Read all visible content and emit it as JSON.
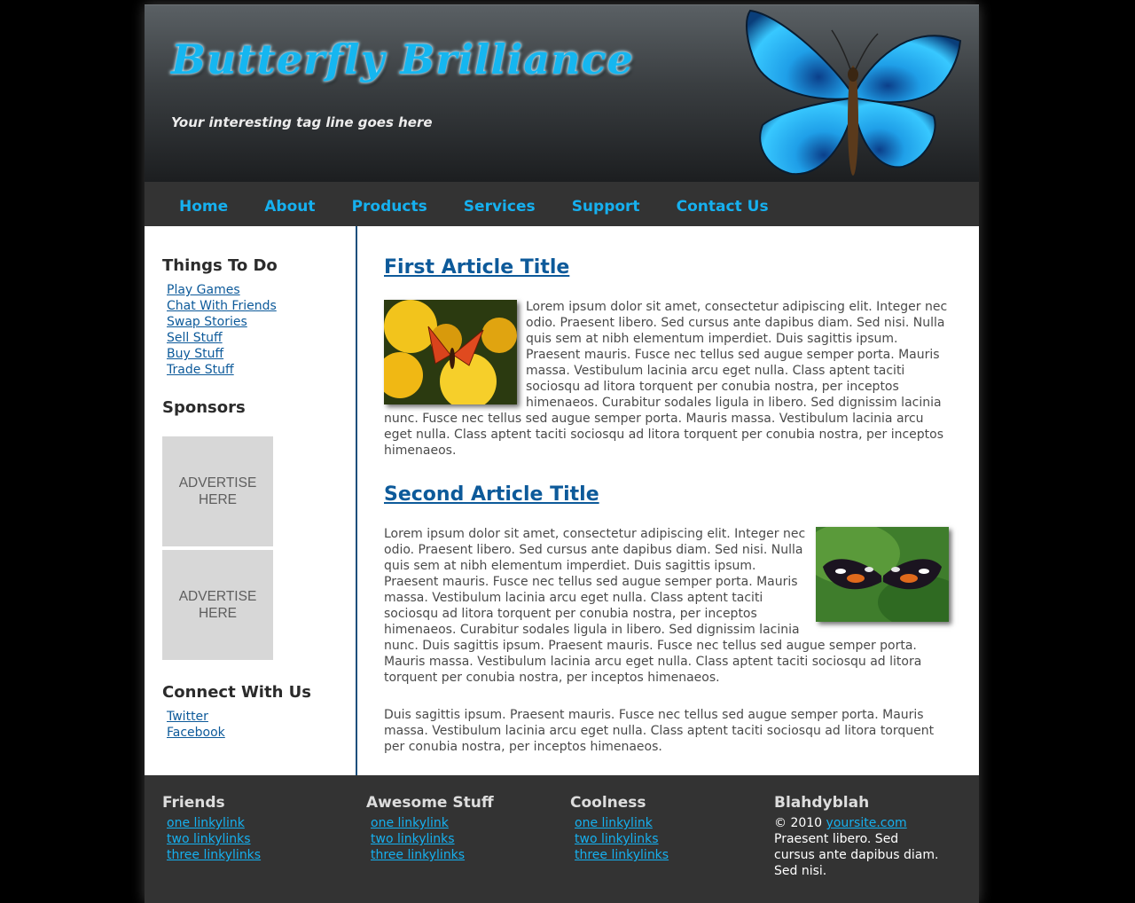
{
  "header": {
    "logo": "Butterfly Brilliance",
    "tagline": "Your interesting tag line goes here"
  },
  "nav": [
    "Home",
    "About",
    "Products",
    "Services",
    "Support",
    "Contact Us"
  ],
  "sidebar": {
    "things_title": "Things To Do",
    "things": [
      "Play Games",
      "Chat With Friends",
      "Swap Stories",
      "Sell Stuff",
      "Buy Stuff",
      "Trade Stuff"
    ],
    "sponsors_title": "Sponsors",
    "ads": [
      "ADVERTISE HERE",
      "ADVERTISE HERE"
    ],
    "connect_title": "Connect With Us",
    "connect": [
      "Twitter",
      "Facebook"
    ]
  },
  "articles": [
    {
      "title": "First Article Title",
      "text": "Lorem ipsum dolor sit amet, consectetur adipiscing elit. Integer nec odio. Praesent libero. Sed cursus ante dapibus diam. Sed nisi. Nulla quis sem at nibh elementum imperdiet. Duis sagittis ipsum. Praesent mauris. Fusce nec tellus sed augue semper porta. Mauris massa. Vestibulum lacinia arcu eget nulla. Class aptent taciti sociosqu ad litora torquent per conubia nostra, per inceptos himenaeos. Curabitur sodales ligula in libero. Sed dignissim lacinia nunc. Fusce nec tellus sed augue semper porta. Mauris massa. Vestibulum lacinia arcu eget nulla. Class aptent taciti sociosqu ad litora torquent per conubia nostra, per inceptos himenaeos."
    },
    {
      "title": "Second Article Title",
      "text": "Lorem ipsum dolor sit amet, consectetur adipiscing elit. Integer nec odio. Praesent libero. Sed cursus ante dapibus diam. Sed nisi. Nulla quis sem at nibh elementum imperdiet. Duis sagittis ipsum. Praesent mauris. Fusce nec tellus sed augue semper porta. Mauris massa. Vestibulum lacinia arcu eget nulla. Class aptent taciti sociosqu ad litora torquent per conubia nostra, per inceptos himenaeos. Curabitur sodales ligula in libero. Sed dignissim lacinia nunc. Duis sagittis ipsum. Praesent mauris. Fusce nec tellus sed augue semper porta. Mauris massa. Vestibulum lacinia arcu eget nulla. Class aptent taciti sociosqu ad litora torquent per conubia nostra, per inceptos himenaeos.",
      "text2": "Duis sagittis ipsum. Praesent mauris. Fusce nec tellus sed augue semper porta. Mauris massa. Vestibulum lacinia arcu eget nulla. Class aptent taciti sociosqu ad litora torquent per conubia nostra, per inceptos himenaeos."
    }
  ],
  "footer": {
    "cols": [
      {
        "title": "Friends",
        "links": [
          "one linkylink",
          "two linkylinks",
          "three linkylinks"
        ]
      },
      {
        "title": "Awesome Stuff",
        "links": [
          "one linkylink",
          "two linkylinks",
          "three linkylinks"
        ]
      },
      {
        "title": "Coolness",
        "links": [
          "one linkylink",
          "two linkylinks",
          "three linkylinks"
        ]
      }
    ],
    "about_title": "Blahdyblah",
    "copyright": "© 2010",
    "site_link": "yoursite.com",
    "about_text": "Praesent libero. Sed cursus ante dapibus diam. Sed nisi."
  },
  "colors": {
    "accent": "#16b0ef",
    "link": "#0d5a9a",
    "dark_bar": "#333333",
    "butterfly_blue": "#1aa8ee"
  }
}
